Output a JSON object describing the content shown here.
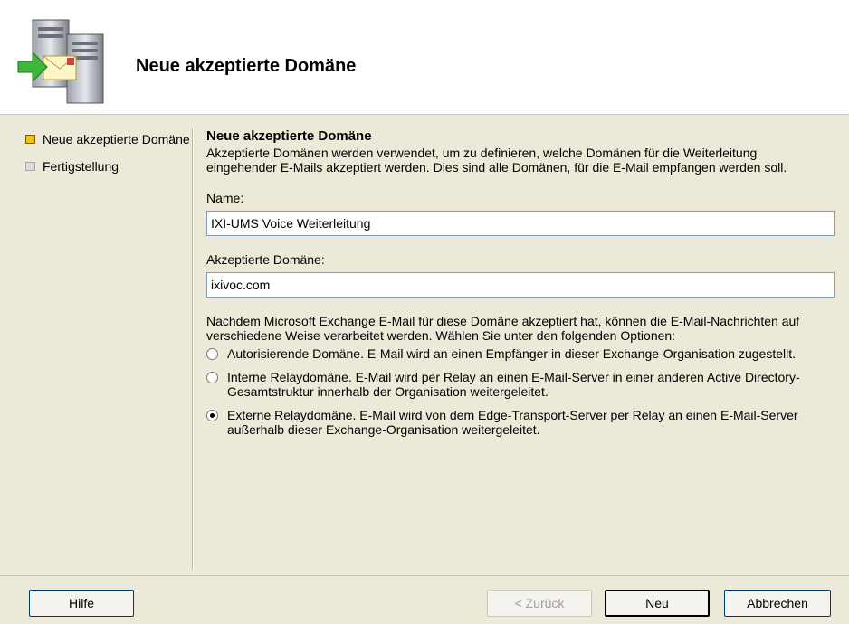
{
  "header": {
    "title": "Neue akzeptierte Domäne",
    "icon": "server-mail-icon"
  },
  "steps": [
    {
      "label": "Neue akzeptierte Domäne",
      "state": "active"
    },
    {
      "label": "Fertigstellung",
      "state": "inactive"
    }
  ],
  "main": {
    "section_title": "Neue akzeptierte Domäne",
    "description": "Akzeptierte Domänen werden verwendet, um zu definieren, welche Domänen für die Weiterleitung eingehender E-Mails akzeptiert werden. Dies sind alle Domänen, für die E-Mail empfangen werden soll.",
    "name_label": "Name:",
    "name_value": "IXI-UMS Voice Weiterleitung",
    "domain_label": "Akzeptierte Domäne:",
    "domain_value": "ixivoc.com",
    "options_intro": "Nachdem Microsoft Exchange E-Mail für diese Domäne akzeptiert hat, können die E-Mail-Nachrichten auf verschiedene Weise verarbeitet werden. Wählen Sie unter den folgenden Optionen:",
    "options": [
      {
        "label": "Autorisierende Domäne. E-Mail wird an einen Empfänger in dieser Exchange-Organisation zugestellt.",
        "checked": false
      },
      {
        "label": "Interne Relaydomäne. E-Mail wird per Relay an einen E-Mail-Server in einer anderen Active Directory-Gesamtstruktur innerhalb der Organisation weitergeleitet.",
        "checked": false
      },
      {
        "label": "Externe Relaydomäne. E-Mail wird von dem Edge-Transport-Server per Relay an einen E-Mail-Server außerhalb dieser Exchange-Organisation weitergeleitet.",
        "checked": true
      }
    ]
  },
  "footer": {
    "help_label": "Hilfe",
    "back_label": "< Zurück",
    "new_label": "Neu",
    "cancel_label": "Abbrechen"
  },
  "colors": {
    "step_active": "#f5c400",
    "dialog_bg": "#ece9d8",
    "input_border": "#7f9db9"
  }
}
